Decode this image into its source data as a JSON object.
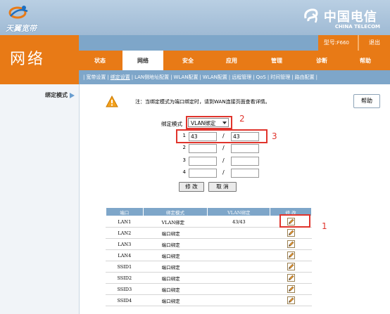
{
  "brand": {
    "left_logo_text": "天翼宽带",
    "right_logo_cn": "中国电信",
    "right_logo_en": "CHINA TELECOM"
  },
  "section_title": "网络",
  "model": {
    "label": "型号:",
    "value": "F660"
  },
  "logout_label": "退出",
  "main_nav": [
    {
      "label": "状态"
    },
    {
      "label": "网络"
    },
    {
      "label": "安全"
    },
    {
      "label": "应用"
    },
    {
      "label": "管理"
    },
    {
      "label": "诊断"
    },
    {
      "label": "帮助"
    }
  ],
  "sub_nav": [
    {
      "label": "宽带设置"
    },
    {
      "label": "绑定设置"
    },
    {
      "label": "LAN侧地址配置"
    },
    {
      "label": "WLAN配置"
    },
    {
      "label": "WLAN配置"
    },
    {
      "label": "远程管理"
    },
    {
      "label": "QoS"
    },
    {
      "label": "时间管理"
    },
    {
      "label": "路由配置"
    }
  ],
  "sidebar": {
    "item_label": "绑定模式"
  },
  "help_label": "帮助",
  "note_text": "注：当绑定模式为端口绑定时，请到WAN连接页面查看详情。",
  "mode": {
    "label": "绑定模式",
    "selected": "VLAN绑定"
  },
  "vlan_rows": [
    {
      "index": "1",
      "left": "43",
      "right": "43"
    },
    {
      "index": "2",
      "left": "",
      "right": ""
    },
    {
      "index": "3",
      "left": "",
      "right": ""
    },
    {
      "index": "4",
      "left": "",
      "right": ""
    }
  ],
  "buttons": {
    "modify": "修 改",
    "cancel": "取 消"
  },
  "annotations": {
    "n1": "1",
    "n2": "2",
    "n3": "3"
  },
  "table": {
    "headers": [
      "端口",
      "绑定模式",
      "VLAN绑定",
      "修 改"
    ],
    "rows": [
      {
        "port": "LAN1",
        "mode": "VLAN绑定",
        "vlan": "43/43"
      },
      {
        "port": "LAN2",
        "mode": "端口绑定",
        "vlan": ""
      },
      {
        "port": "LAN3",
        "mode": "端口绑定",
        "vlan": ""
      },
      {
        "port": "LAN4",
        "mode": "端口绑定",
        "vlan": ""
      },
      {
        "port": "SSID1",
        "mode": "端口绑定",
        "vlan": ""
      },
      {
        "port": "SSID2",
        "mode": "端口绑定",
        "vlan": ""
      },
      {
        "port": "SSID3",
        "mode": "端口绑定",
        "vlan": ""
      },
      {
        "port": "SSID4",
        "mode": "端口绑定",
        "vlan": ""
      }
    ]
  },
  "colors": {
    "orange": "#e87a16",
    "blue": "#7ea6c9",
    "annotation_red": "#e0342c"
  }
}
